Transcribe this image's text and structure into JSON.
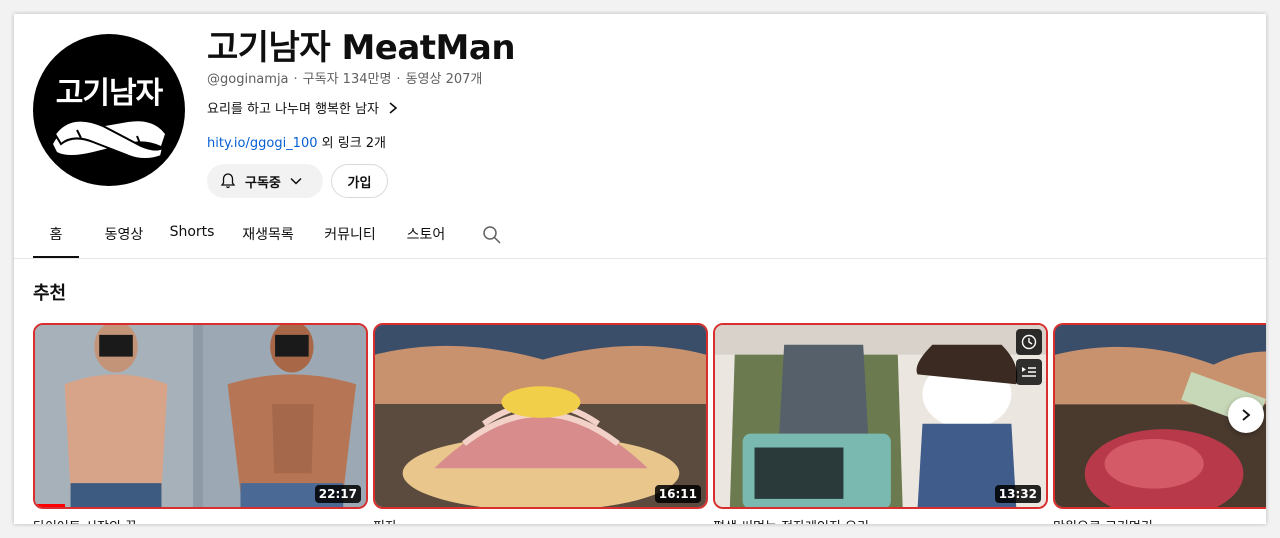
{
  "channel": {
    "avatar_text": "고기남자",
    "name": "고기남자 MeatMan",
    "handle": "@goginamja",
    "subscribers": "구독자 134만명",
    "videos": "동영상 207개",
    "description": "요리를 하고 나누며 행복한 남자",
    "link_url": "hity.io/ggogi_100",
    "link_more": "외 링크 2개"
  },
  "buttons": {
    "subscribed_label": "구독중",
    "join_label": "가입"
  },
  "tabs": [
    {
      "label": "홈",
      "active": true
    },
    {
      "label": "동영상",
      "active": false
    },
    {
      "label": "Shorts",
      "active": false
    },
    {
      "label": "재생목록",
      "active": false
    },
    {
      "label": "커뮤니티",
      "active": false
    },
    {
      "label": "스토어",
      "active": false
    }
  ],
  "section": {
    "title": "추천"
  },
  "videos": [
    {
      "duration": "22:17",
      "progress": 0.09,
      "title": "다이어트 시작의 끝"
    },
    {
      "duration": "16:11",
      "progress": 0,
      "title": "피자"
    },
    {
      "duration": "13:32",
      "progress": 0,
      "title": "평생 써먹는 전자레인지 요리"
    },
    {
      "duration": "",
      "progress": 0,
      "title": "만원으로 고기먹기"
    }
  ],
  "colors": {
    "accent_red": "#ff0000",
    "link_blue": "#065fd4",
    "hover_border": "#d92e2e"
  },
  "icons": [
    "bell-icon",
    "chevron-down-icon",
    "chevron-right-icon",
    "search-icon",
    "clock-icon",
    "queue-icon",
    "next-arrow-icon"
  ]
}
